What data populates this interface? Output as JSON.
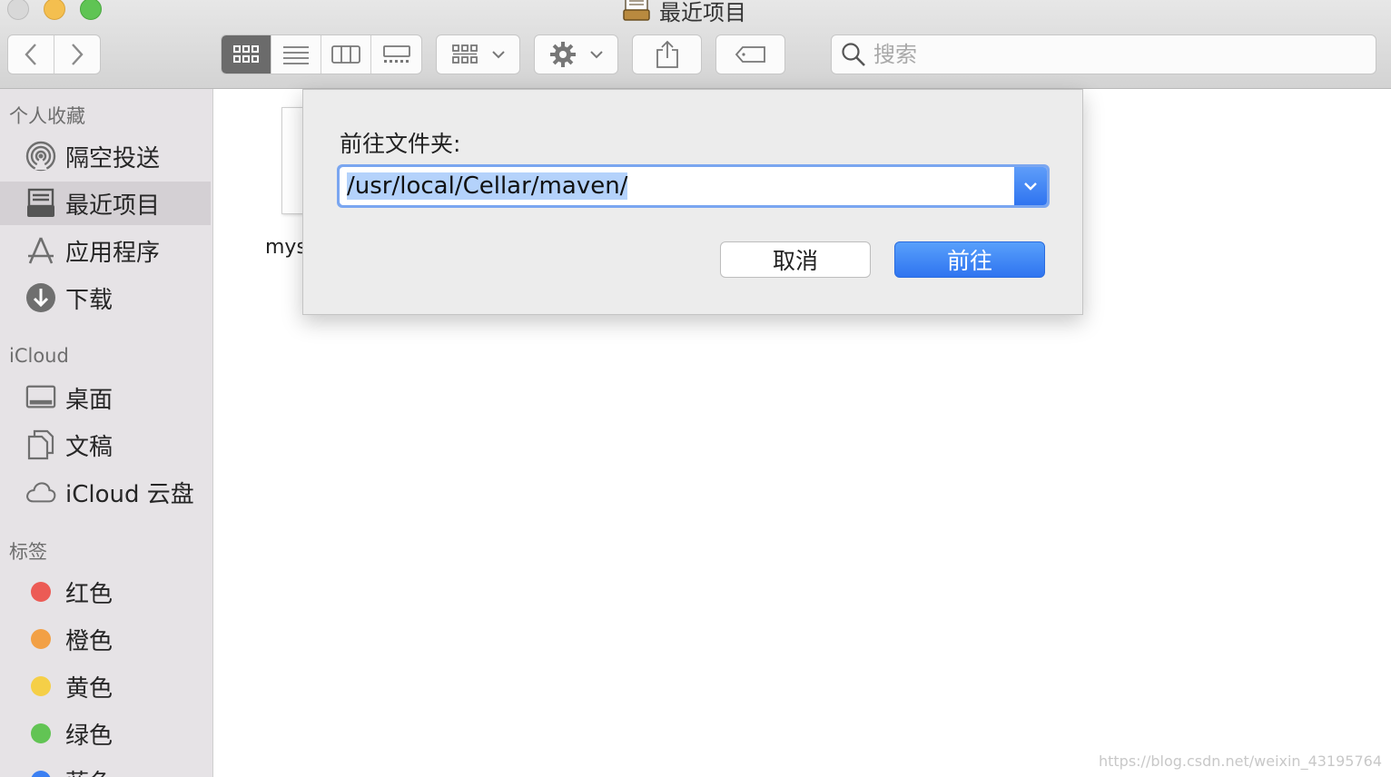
{
  "window": {
    "title": "最近项目",
    "title_icon": "inbox-icon"
  },
  "toolbar": {
    "nav": [
      "chevron-left-icon",
      "chevron-right-icon"
    ],
    "view_modes": [
      "icon-view",
      "list-view",
      "column-view",
      "gallery-view"
    ],
    "active_view": "icon-view",
    "arrange_icon": "grid-icon",
    "action_icon": "gear-icon",
    "share_icon": "share-icon",
    "tag_icon": "tag-icon",
    "search_placeholder": "搜索"
  },
  "sidebar": {
    "favorites_header": "个人收藏",
    "favorites": [
      {
        "label": "隔空投送",
        "icon": "airdrop-icon"
      },
      {
        "label": "最近项目",
        "icon": "recents-icon",
        "selected": true
      },
      {
        "label": "应用程序",
        "icon": "applications-icon"
      },
      {
        "label": "下载",
        "icon": "downloads-icon"
      }
    ],
    "icloud_header": "iCloud",
    "icloud": [
      {
        "label": "桌面",
        "icon": "desktop-icon"
      },
      {
        "label": "文稿",
        "icon": "documents-icon"
      },
      {
        "label": "iCloud 云盘",
        "icon": "cloud-icon"
      }
    ],
    "tags_header": "标签",
    "tags": [
      {
        "label": "红色",
        "color": "#ec5b55"
      },
      {
        "label": "橙色",
        "color": "#f2a045"
      },
      {
        "label": "黄色",
        "color": "#f5cf47"
      },
      {
        "label": "绿色",
        "color": "#62c454"
      },
      {
        "label": "蓝色",
        "color": "#3b7ff2"
      }
    ]
  },
  "content": {
    "file_name": "mys",
    "watermark": "https://blog.csdn.net/weixin_43195764"
  },
  "dialog": {
    "label": "前往文件夹:",
    "path": "/usr/local/Cellar/maven/",
    "cancel": "取消",
    "go": "前往"
  },
  "colors": {
    "accent": "#2f74f0",
    "sidebar_bg": "#e6e3e6",
    "selection": "#b4d2fb"
  }
}
